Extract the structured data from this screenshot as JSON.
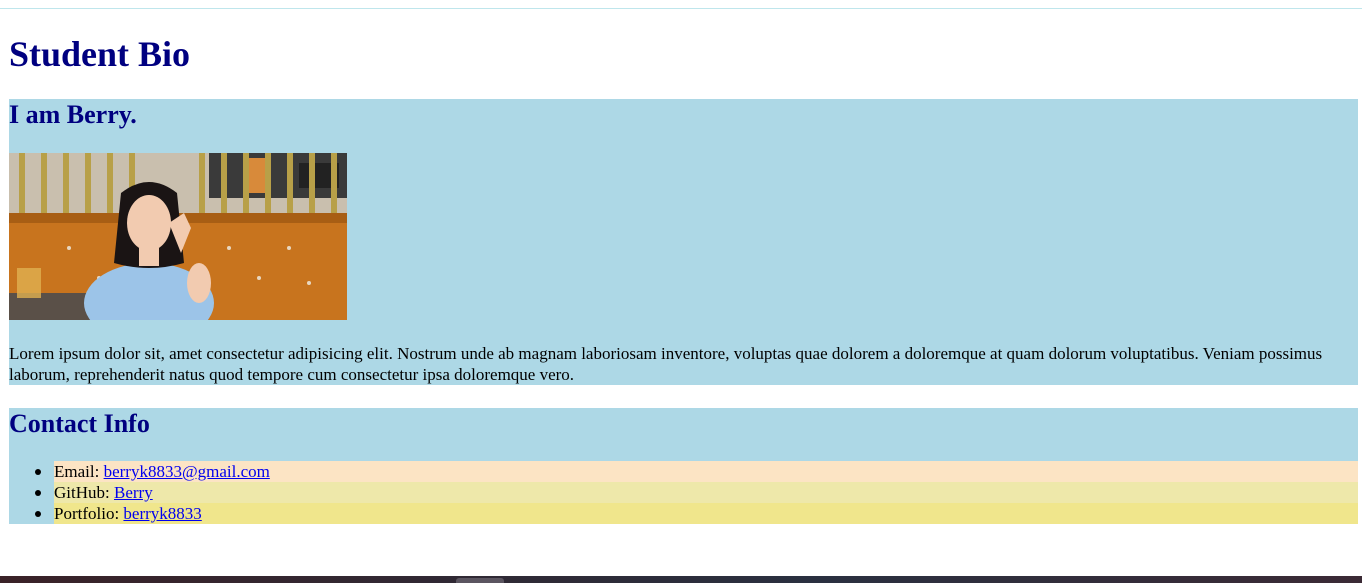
{
  "page": {
    "title": "Student Bio"
  },
  "bio": {
    "heading": "I am Berry.",
    "photo_alt": "Photo of Berry",
    "text": "Lorem ipsum dolor sit, amet consectetur adipisicing elit. Nostrum unde ab magnam laboriosam inventore, voluptas quae dolorem a doloremque at quam dolorum voluptatibus. Veniam possimus laborum, reprehenderit natus quod tempore cum consectetur ipsa doloremque vero."
  },
  "contact": {
    "heading": "Contact Info",
    "items": [
      {
        "label": "Email: ",
        "link_text": "berryk8833@gmail.com",
        "bg": "#fce4c4"
      },
      {
        "label": "GitHub: ",
        "link_text": "Berry",
        "bg": "#eee8aa"
      },
      {
        "label": "Portfolio: ",
        "link_text": "berryk8833",
        "bg": "#f0e68c"
      }
    ]
  },
  "colors": {
    "heading": "#000080",
    "section_bg": "#add8e6",
    "link": "#0000ee"
  }
}
